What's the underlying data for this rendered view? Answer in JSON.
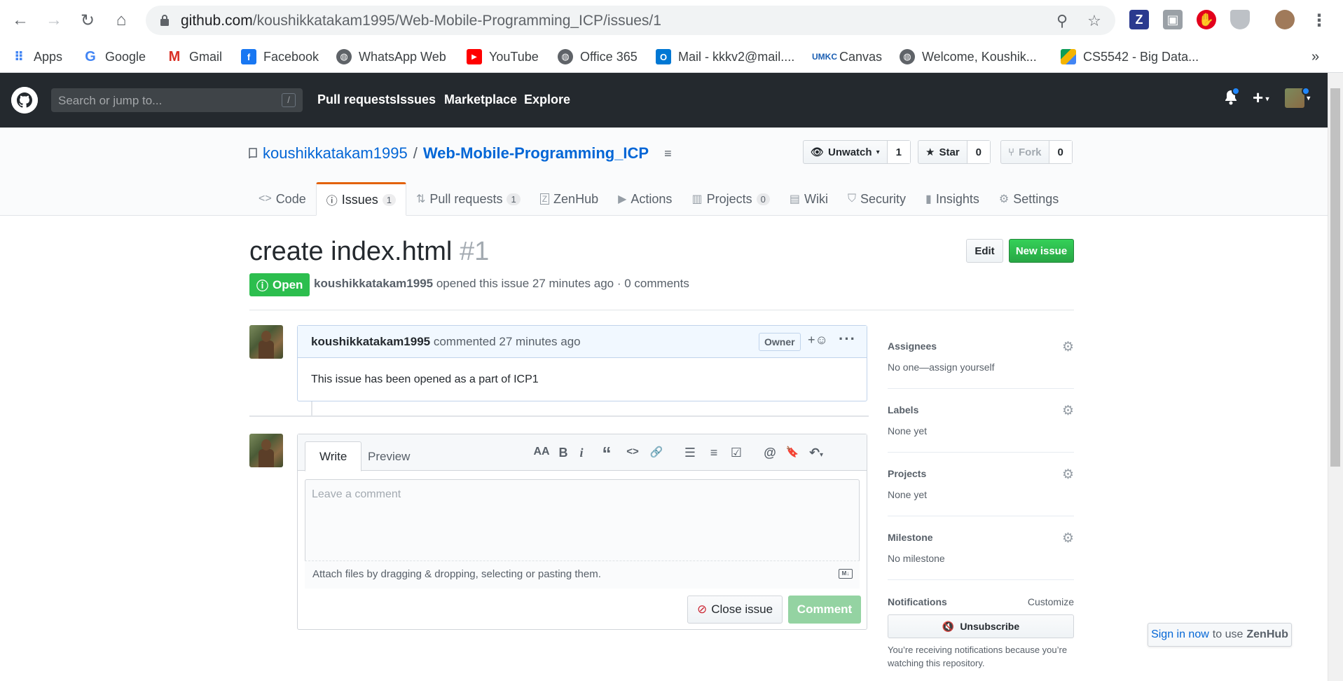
{
  "browser": {
    "url_host": "github.com",
    "url_path": "/koushikkatakam1995/Web-Mobile-Programming_ICP/issues/1",
    "bookmarks": [
      "Apps",
      "Google",
      "Gmail",
      "Facebook",
      "WhatsApp Web",
      "YouTube",
      "Office 365",
      "Mail - kkkv2@mail....",
      "Canvas",
      "Welcome, Koushik...",
      "CS5542 - Big Data..."
    ],
    "overflow": "»"
  },
  "gh_header": {
    "search_placeholder": "Search or jump to...",
    "search_shortcut": "/",
    "nav": [
      "Pull requests",
      "Issues",
      "Marketplace",
      "Explore"
    ],
    "plus": "+"
  },
  "repo": {
    "owner": "koushikkatakam1995",
    "separator": "/",
    "name": "Web-Mobile-Programming_ICP",
    "watch_label": "Unwatch",
    "watch_count": "1",
    "star_label": "Star",
    "star_count": "0",
    "fork_label": "Fork",
    "fork_count": "0",
    "tabs": [
      {
        "label": "Code",
        "counter": ""
      },
      {
        "label": "Issues",
        "counter": "1"
      },
      {
        "label": "Pull requests",
        "counter": "1"
      },
      {
        "label": "ZenHub",
        "counter": ""
      },
      {
        "label": "Actions",
        "counter": ""
      },
      {
        "label": "Projects",
        "counter": "0"
      },
      {
        "label": "Wiki",
        "counter": ""
      },
      {
        "label": "Security",
        "counter": ""
      },
      {
        "label": "Insights",
        "counter": ""
      },
      {
        "label": "Settings",
        "counter": ""
      }
    ]
  },
  "issue": {
    "title": "create index.html",
    "number": "#1",
    "edit_label": "Edit",
    "new_label": "New issue",
    "state": "Open",
    "author": "koushikkatakam1995",
    "meta_text": "opened this issue 27 minutes ago · 0 comments"
  },
  "comment": {
    "author": "koushikkatakam1995",
    "when": "commented 27 minutes ago",
    "badge": "Owner",
    "react": "+☺",
    "more": "···",
    "body": "This issue has been opened as a part of ICP1"
  },
  "form": {
    "write_tab": "Write",
    "preview_tab": "Preview",
    "tools": [
      "AA",
      "B",
      "i",
      "“",
      "<>",
      "🔗",
      "☰",
      "≡",
      "☑",
      "@",
      "🔖",
      "↶"
    ],
    "placeholder": "Leave a comment",
    "attach_text": "Attach files by dragging & dropping, selecting or pasting them.",
    "md_badge": "M↓",
    "close_label": "Close issue",
    "comment_label": "Comment"
  },
  "sidebar": {
    "assignees": {
      "head": "Assignees",
      "value": "No one—assign yourself"
    },
    "labels": {
      "head": "Labels",
      "value": "None yet"
    },
    "projects": {
      "head": "Projects",
      "value": "None yet"
    },
    "milestone": {
      "head": "Milestone",
      "value": "No milestone"
    },
    "notifications": {
      "head": "Notifications",
      "customize": "Customize",
      "unsubscribe": "Unsubscribe",
      "notice": "You’re receiving notifications because you’re watching this repository."
    }
  },
  "zenhub": {
    "link": "Sign in now",
    "mid": "to use",
    "brand": "ZenHub"
  },
  "colors": {
    "github_dark": "#24292e",
    "link_blue": "#0366d6",
    "open_green": "#2cbe4e",
    "issues_tab_accent": "#e36209"
  }
}
